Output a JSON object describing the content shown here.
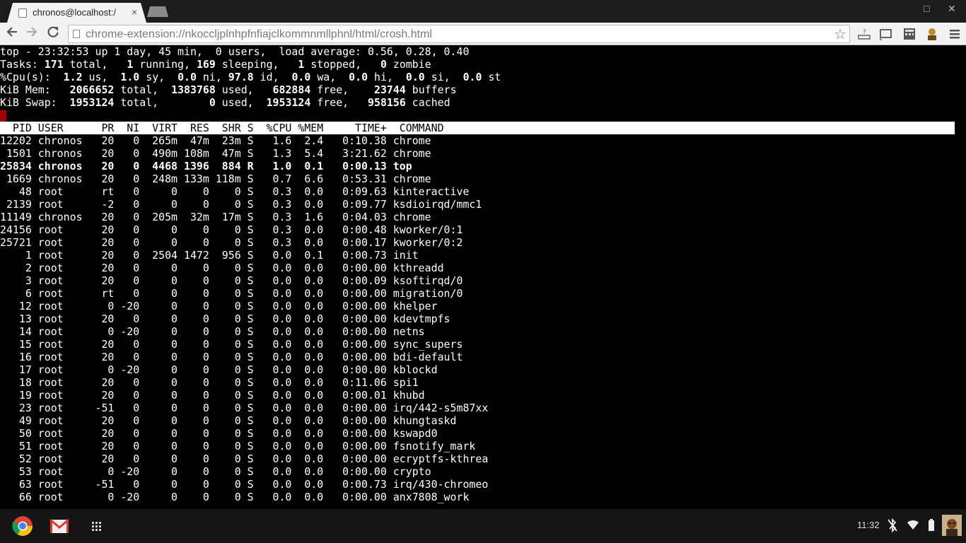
{
  "window": {
    "tab_title": "chronos@localhost:/",
    "tab_close": "×",
    "minimize": "□",
    "close": "✕"
  },
  "toolbar": {
    "url": "chrome-extension://nkoccljplnhpfnfiajclkommnmllphnl/html/crosh.html"
  },
  "terminal": {
    "summary": [
      [
        {
          "t": "top - 23:32:53 up 1 day, 45 min,  0 users,  load average: 0.56, 0.28, 0.40"
        }
      ],
      [
        {
          "t": "Tasks: "
        },
        {
          "t": "171",
          "b": 1
        },
        {
          "t": " total,   "
        },
        {
          "t": "1",
          "b": 1
        },
        {
          "t": " running, "
        },
        {
          "t": "169",
          "b": 1
        },
        {
          "t": " sleeping,   "
        },
        {
          "t": "1",
          "b": 1
        },
        {
          "t": " stopped,   "
        },
        {
          "t": "0",
          "b": 1
        },
        {
          "t": " zombie"
        }
      ],
      [
        {
          "t": "%Cpu(s):  "
        },
        {
          "t": "1.2",
          "b": 1
        },
        {
          "t": " us,  "
        },
        {
          "t": "1.0",
          "b": 1
        },
        {
          "t": " sy,  "
        },
        {
          "t": "0.0",
          "b": 1
        },
        {
          "t": " ni, "
        },
        {
          "t": "97.8",
          "b": 1
        },
        {
          "t": " id,  "
        },
        {
          "t": "0.0",
          "b": 1
        },
        {
          "t": " wa,  "
        },
        {
          "t": "0.0",
          "b": 1
        },
        {
          "t": " hi,  "
        },
        {
          "t": "0.0",
          "b": 1
        },
        {
          "t": " si,  "
        },
        {
          "t": "0.0",
          "b": 1
        },
        {
          "t": " st"
        }
      ],
      [
        {
          "t": "KiB Mem:   "
        },
        {
          "t": "2066652",
          "b": 1
        },
        {
          "t": " total,  "
        },
        {
          "t": "1383768",
          "b": 1
        },
        {
          "t": " used,   "
        },
        {
          "t": "682884",
          "b": 1
        },
        {
          "t": " free,    "
        },
        {
          "t": "23744",
          "b": 1
        },
        {
          "t": " buffers"
        }
      ],
      [
        {
          "t": "KiB Swap:  "
        },
        {
          "t": "1953124",
          "b": 1
        },
        {
          "t": " total,        "
        },
        {
          "t": "0",
          "b": 1
        },
        {
          "t": " used,  "
        },
        {
          "t": "1953124",
          "b": 1
        },
        {
          "t": " free,   "
        },
        {
          "t": "958156",
          "b": 1
        },
        {
          "t": " cached"
        }
      ]
    ],
    "header": "  PID USER      PR  NI  VIRT  RES  SHR S  %CPU %MEM     TIME+  COMMAND",
    "processes": [
      {
        "line": "12202 chronos   20   0  265m  47m  23m S   1.6  2.4   0:10.38 chrome",
        "bold": false
      },
      {
        "line": " 1501 chronos   20   0  490m 108m  47m S   1.3  5.4   3:21.62 chrome",
        "bold": false
      },
      {
        "line": "25834 chronos   20   0  4468 1396  884 R   1.0  0.1   0:00.13 top",
        "bold": true
      },
      {
        "line": " 1669 chronos   20   0  248m 133m 118m S   0.7  6.6   0:53.31 chrome",
        "bold": false
      },
      {
        "line": "   48 root      rt   0     0    0    0 S   0.3  0.0   0:09.63 kinteractive",
        "bold": false
      },
      {
        "line": " 2139 root      -2   0     0    0    0 S   0.3  0.0   0:09.77 ksdioirqd/mmc1",
        "bold": false
      },
      {
        "line": "11149 chronos   20   0  205m  32m  17m S   0.3  1.6   0:04.03 chrome",
        "bold": false
      },
      {
        "line": "24156 root      20   0     0    0    0 S   0.3  0.0   0:00.48 kworker/0:1",
        "bold": false
      },
      {
        "line": "25721 root      20   0     0    0    0 S   0.3  0.0   0:00.17 kworker/0:2",
        "bold": false
      },
      {
        "line": "    1 root      20   0  2504 1472  956 S   0.0  0.1   0:00.73 init",
        "bold": false
      },
      {
        "line": "    2 root      20   0     0    0    0 S   0.0  0.0   0:00.00 kthreadd",
        "bold": false
      },
      {
        "line": "    3 root      20   0     0    0    0 S   0.0  0.0   0:00.09 ksoftirqd/0",
        "bold": false
      },
      {
        "line": "    6 root      rt   0     0    0    0 S   0.0  0.0   0:00.00 migration/0",
        "bold": false
      },
      {
        "line": "   12 root       0 -20     0    0    0 S   0.0  0.0   0:00.00 khelper",
        "bold": false
      },
      {
        "line": "   13 root      20   0     0    0    0 S   0.0  0.0   0:00.00 kdevtmpfs",
        "bold": false
      },
      {
        "line": "   14 root       0 -20     0    0    0 S   0.0  0.0   0:00.00 netns",
        "bold": false
      },
      {
        "line": "   15 root      20   0     0    0    0 S   0.0  0.0   0:00.00 sync_supers",
        "bold": false
      },
      {
        "line": "   16 root      20   0     0    0    0 S   0.0  0.0   0:00.00 bdi-default",
        "bold": false
      },
      {
        "line": "   17 root       0 -20     0    0    0 S   0.0  0.0   0:00.00 kblockd",
        "bold": false
      },
      {
        "line": "   18 root      20   0     0    0    0 S   0.0  0.0   0:11.06 spi1",
        "bold": false
      },
      {
        "line": "   19 root      20   0     0    0    0 S   0.0  0.0   0:00.01 khubd",
        "bold": false
      },
      {
        "line": "   23 root     -51   0     0    0    0 S   0.0  0.0   0:00.00 irq/442-s5m87xx",
        "bold": false
      },
      {
        "line": "   49 root      20   0     0    0    0 S   0.0  0.0   0:00.00 khungtaskd",
        "bold": false
      },
      {
        "line": "   50 root      20   0     0    0    0 S   0.0  0.0   0:00.00 kswapd0",
        "bold": false
      },
      {
        "line": "   51 root      20   0     0    0    0 S   0.0  0.0   0:00.00 fsnotify_mark",
        "bold": false
      },
      {
        "line": "   52 root      20   0     0    0    0 S   0.0  0.0   0:00.00 ecryptfs-kthrea",
        "bold": false
      },
      {
        "line": "   53 root       0 -20     0    0    0 S   0.0  0.0   0:00.00 crypto",
        "bold": false
      },
      {
        "line": "   63 root     -51   0     0    0    0 S   0.0  0.0   0:00.73 irq/430-chromeo",
        "bold": false
      },
      {
        "line": "   66 root       0 -20     0    0    0 S   0.0  0.0   0:00.00 anx7808_work",
        "bold": false
      }
    ]
  },
  "shelf": {
    "clock": "11:32",
    "apps": [
      "chrome-icon",
      "gmail-icon",
      "app-launcher-icon"
    ]
  }
}
